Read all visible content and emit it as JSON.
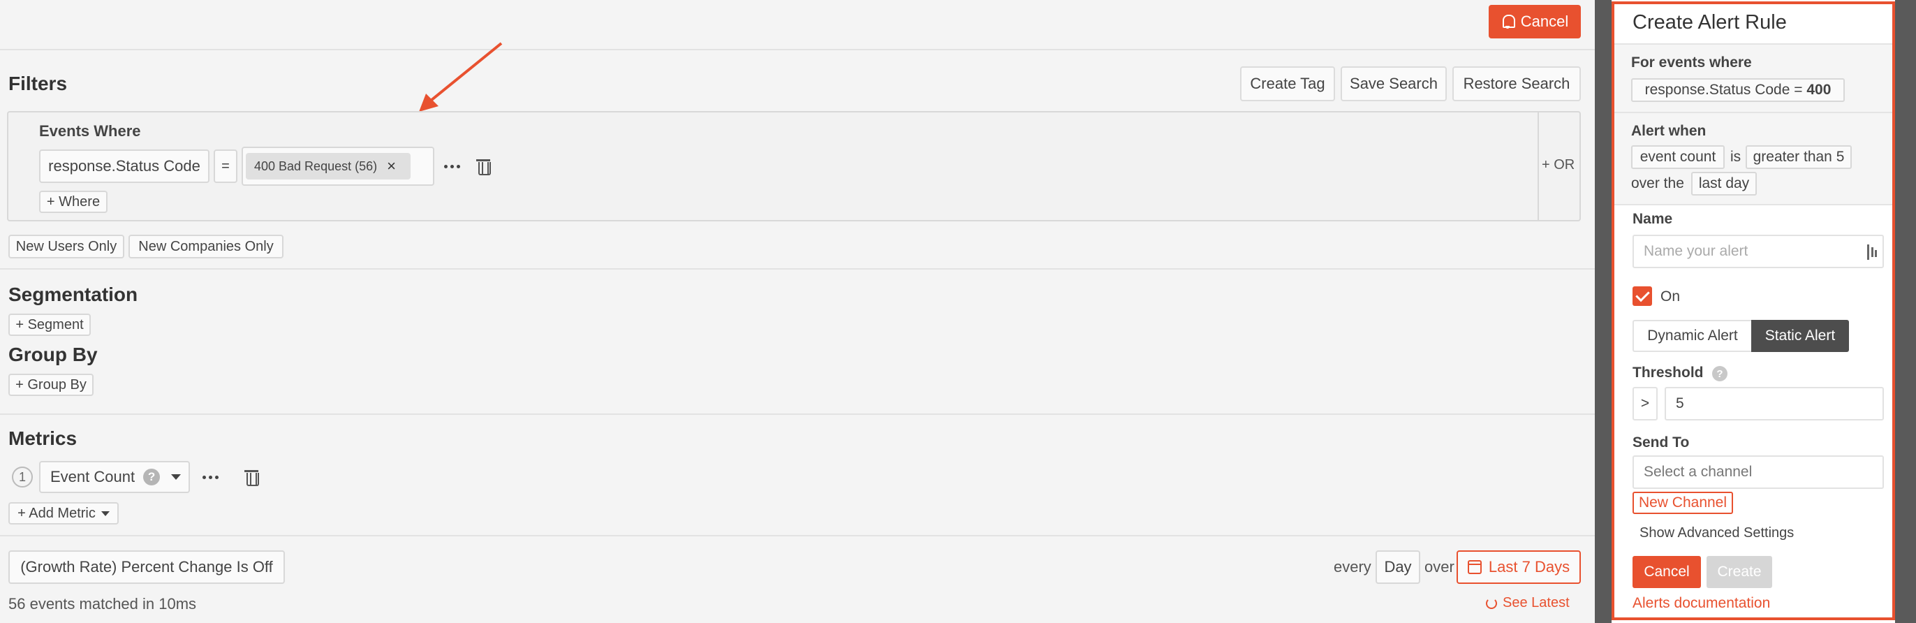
{
  "header": {
    "cancel_label": "Cancel"
  },
  "filters": {
    "title": "Filters",
    "actions": {
      "create_tag": "Create Tag",
      "save_search": "Save Search",
      "restore_search": "Restore Search"
    },
    "events_where_label": "Events Where",
    "field": "response.Status Code",
    "operator": "=",
    "value_tag": "400 Bad Request (56)",
    "remove_symbol": "×",
    "add_where": "+ Where",
    "or_label": "+ OR",
    "quick_filters": [
      "New Users Only",
      "New Companies Only"
    ]
  },
  "segmentation": {
    "title": "Segmentation",
    "add_label": "+ Segment"
  },
  "group_by": {
    "title": "Group By",
    "add_label": "+ Group By"
  },
  "metrics": {
    "title": "Metrics",
    "items": [
      {
        "index": "1",
        "label": "Event Count",
        "help": "?"
      }
    ],
    "add_label": "+ Add Metric"
  },
  "footer": {
    "growth_rate": "(Growth Rate) Percent Change Is Off",
    "every_label": "every",
    "interval": "Day",
    "over_label": "over",
    "date_range": "Last 7 Days",
    "matched_text": "56 events matched in 10ms",
    "see_latest": "See Latest"
  },
  "alert_panel": {
    "title": "Create Alert Rule",
    "for_events_label": "For events where",
    "condition_field": "response.Status Code = ",
    "condition_value": "400",
    "alert_when_label": "Alert when",
    "metric": "event count",
    "is_word": "is",
    "comparison": "greater than 5",
    "over_the": "over the",
    "window": "last day",
    "name_label": "Name",
    "name_placeholder": "Name your alert",
    "on_label": "On",
    "alert_types": [
      "Dynamic Alert",
      "Static Alert"
    ],
    "selected_type": "Static Alert",
    "threshold_label": "Threshold",
    "threshold_help": "?",
    "threshold_operator": ">",
    "threshold_value": "5",
    "send_to_label": "Send To",
    "channel_placeholder": "Select a channel",
    "new_channel": "New Channel",
    "advanced_settings": "Show Advanced Settings",
    "cancel_label": "Cancel",
    "create_label": "Create",
    "docs_link": "Alerts documentation"
  },
  "colors": {
    "accent": "#e8512f",
    "dark_button": "#4d4d4d",
    "disabled": "#d6d6d6"
  }
}
